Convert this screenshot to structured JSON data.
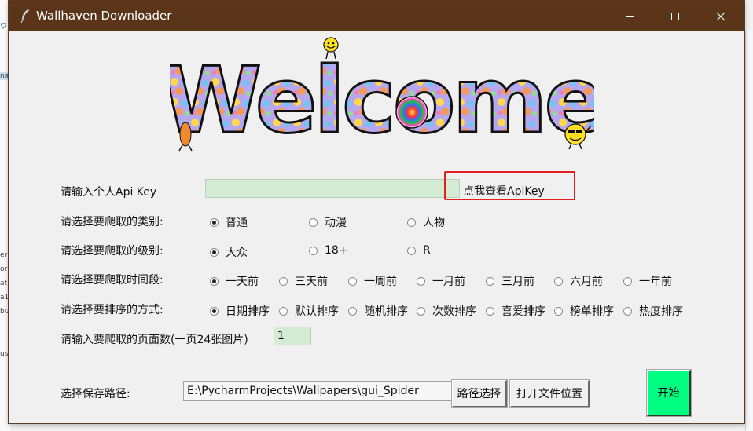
{
  "window": {
    "title": "Wallhaven Downloader"
  },
  "colors": {
    "titlebar": "#5a3519",
    "input_bg": "#d4ecd4",
    "start_button": "#00ff80",
    "highlight_box": "#e02020"
  },
  "banner": {
    "text": "Welcome"
  },
  "api": {
    "label": "请输入个人Api Key",
    "value": "",
    "link_text": "点我查看ApiKey"
  },
  "category": {
    "label": "请选择要爬取的类别:",
    "options": [
      "普通",
      "动漫",
      "人物"
    ],
    "selected": "普通"
  },
  "purity": {
    "label": "请选择要爬取的级别:",
    "options": [
      "大众",
      "18+",
      "R"
    ],
    "selected": "大众"
  },
  "time_range": {
    "label": "请选择要爬取时间段:",
    "options": [
      "一天前",
      "三天前",
      "一周前",
      "一月前",
      "三月前",
      "六月前",
      "一年前"
    ],
    "selected": "一天前"
  },
  "sorting": {
    "label": "请选择要排序的方式:",
    "options": [
      "日期排序",
      "默认排序",
      "随机排序",
      "次数排序",
      "喜爱排序",
      "榜单排序",
      "热度排序"
    ],
    "selected": "日期排序"
  },
  "pages": {
    "label": "请输入要爬取的页面数(一页24张图片)",
    "value": "1"
  },
  "save_path": {
    "label": "选择保存路径:",
    "value": "E:\\PycharmProjects\\Wallpapers\\gui_Spider",
    "choose_button": "路径选择",
    "open_button": "打开文件位置"
  },
  "start_button": "开始",
  "icons": {
    "app": "feather-icon",
    "minimize": "minimize-icon",
    "maximize": "maximize-icon",
    "close": "close-icon"
  }
}
